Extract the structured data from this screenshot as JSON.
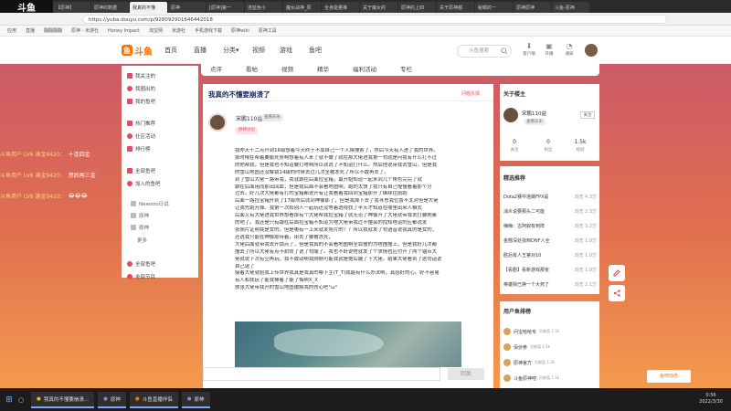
{
  "browser": {
    "tabs": [
      "【原神】",
      "原神的数据",
      "我真的不懂",
      "原神",
      "[原神]第一",
      "连蓝色小",
      "魔女战神_原",
      "全身能量推",
      "关于魔女的",
      "原神的上四",
      "关于原神都",
      "秘眼的一",
      "原神原神",
      "斗鱼-原神"
    ],
    "url": "https://yuba.douyu.com/p/928092901646442018",
    "bookmarks": [
      "应用",
      "直播",
      "翻翻翻翻",
      "原神 - 米游社",
      "Honey Impact",
      "淘宝网",
      "米游社",
      "手机游戏下载",
      "原神wiki",
      "原神工具"
    ]
  },
  "site": {
    "logo_text": "斗鱼",
    "nav": [
      "首页",
      "直播",
      "分类▾",
      "视频",
      "游戏",
      "鱼吧"
    ],
    "search_placeholder": "斗鱼搜索",
    "header_icons": [
      {
        "label": "客户端"
      },
      {
        "label": "开播"
      },
      {
        "label": "通知"
      },
      {
        "label": "历史"
      }
    ]
  },
  "sidebar": {
    "items": [
      {
        "label": "我关注的",
        "color": "#e84a5f"
      },
      {
        "label": "我圈出的",
        "color": "#e84a5f"
      },
      {
        "label": "我的鱼吧",
        "color": "#e84a5f"
      },
      {
        "label": "热门推荐",
        "color": "#e84a5f"
      },
      {
        "label": "社区活动",
        "color": "#e84a5f"
      },
      {
        "label": "排行榜",
        "color": "#e84a5f"
      },
      {
        "label": "全部鱼吧",
        "color": "#e84a5f"
      },
      {
        "label": "加入的鱼吧",
        "color": "#e84a5f"
      },
      {
        "label": "Newzoo日试",
        "color": "#999999"
      },
      {
        "label": "原神",
        "color": "#999999"
      },
      {
        "label": "原神",
        "color": "#999999"
      },
      {
        "label": "更多",
        "color": "#999999"
      },
      {
        "label": "全部鱼吧",
        "color": "#e84a5f"
      },
      {
        "label": "全部节目",
        "color": "#e84a5f"
      }
    ]
  },
  "subtabs": [
    "点评",
    "看帖",
    "视频",
    "精华",
    "福利活动",
    "专栏"
  ],
  "article": {
    "title": "我真的不懂要崩溃了",
    "report": "问题反馈",
    "author": "宋鹏110益",
    "author_badge": "查看乐乐",
    "author_tag": "原神讨论",
    "body_lines": [
      "我昨天十二点升到16级想着今天终于不靠自己一个人摸搜索了，然后今天有人进了我的世界。",
      "那时候在帮着要偷死务啊想着有人来了就不做了就在那大佬进我第一句就是问我有什么打不过",
      "的他帮我。但是我也不知道要打啥啊所以就说了不知道打什么。然后他说带我去雪山，但是我",
      "的雪山地图还没解锁14级的时候去过几次全被冻死了所以不敢再去了。",
      "到了雪山大佬一路带我，我就跟在后面捡宝箱，最开始知道一起来到几个角色完完了就",
      "跟在后面用而那出回血，但是我后面不会看地图啊，跑的太快了我只有自己慢慢看着那个分",
      "过去。好几次大佬都有打的宝箱都说开有让我看着我回到宝箱那开了继续往前跑",
      "后面一路捡宝箱升到了17级然后就到神像那了，但是我掉下去了我寻思我位置不太对但是大佬",
      "让我先跑开掉。我第一次和别人一起玩还没等着透视找了半天才知道在哪里出来人模式",
      "后面又有大佬进我世界想看那有个大佬帮我捡宝箱了就无论了神像开了大佬就带我去打要刷素",
      "的地了。我还是只有跟在后面捡宝箱不知道为啥大佬带我过不懂会的找知啥道的应都说发",
      "张照片证明我是女的。但是哪有一上来就发照片的？？所以我就发了句语音说我真的是女的，",
      "还说我只能在神像那待着，出去了要被冻死，",
      "大佬后面就带我去开锁点了，但是我真的不会看地图啊全靠撞的为啥撞撞上，但是我好几次都",
      "撞丢了所以大佬有点不耐烦了说了句服了。我也不好说啥就发了个求情包应付开了两个锚点大",
      "佬就说下次有空再玩。我不敢动啊我刚刚可能我就是拖后腿了下大佬。结果大佬看到了这句话说",
      "自己退了",
      "接着大佬就给我上传世界我真是我真的哪下主(T_T)我能有什么办法啊，真感好的心。好不容易",
      "有人和我玩了能我捧着了能了悔啊X_X",
      "放张大佬带我开的雪山地图缓解我的伤心吧°ω°"
    ]
  },
  "comment": {
    "placeholder": "",
    "button": "回复"
  },
  "moderator": {
    "section_title": "关于楼主",
    "name": "宋鹏110益",
    "badge": "查看乐乐",
    "follow": "关注",
    "stats": [
      {
        "value": "0",
        "label": "关注"
      },
      {
        "value": "0",
        "label": "粉丝"
      },
      {
        "value": "1.5k",
        "label": "经验"
      }
    ]
  },
  "recommend": {
    "title": "精选推荐",
    "items": [
      {
        "title": "Dota2赛中连跳FPX是",
        "hot": "浏览 4.3万"
      },
      {
        "title": "消炎说要那头二可能",
        "hot": "浏览 2.3万"
      },
      {
        "title": "嗨嗨：古阿叙有到阵",
        "hot": "浏览 3.2万"
      },
      {
        "title": "金翘深处找到DNF人全",
        "hot": "浏览 1.9万"
      },
      {
        "title": "胜后有人王第对10",
        "hot": "浏览 1.0万"
      },
      {
        "title": "【看剧】看新游戏那雀",
        "hot": "浏览 1.9万"
      },
      {
        "title": "英雄除已换一个大死了",
        "hot": "浏览 2.1万"
      }
    ]
  },
  "users": {
    "title": "用户鱼排榜",
    "items": [
      {
        "name": "问宝哈哈专",
        "sub": "贡献值 1.5k"
      },
      {
        "name": "佰伏参",
        "sub": "贡献值 2.1k"
      },
      {
        "name": "原神官方",
        "sub": "贡献值 1.3k"
      },
      {
        "name": "斗鱼原神吧",
        "sub": "贡献值 1.1k"
      }
    ]
  },
  "danmu": [
    {
      "user": "斗鱼用户 LV6 满金9420：",
      "text": "十连四金"
    },
    {
      "user": "斗鱼用户 LV6 满金9420：",
      "text": "然后再三金"
    },
    {
      "user": "斗鱼用户 LV6 满金9420：",
      "text": "😂😂😂"
    }
  ],
  "notice": "鱼吧动态",
  "taskbar": {
    "apps": [
      "我真的不懂要崩溃...",
      "原神",
      "斗鱼直播伴侣",
      "原神"
    ],
    "time": "0:56",
    "date": "2022/3/30"
  }
}
